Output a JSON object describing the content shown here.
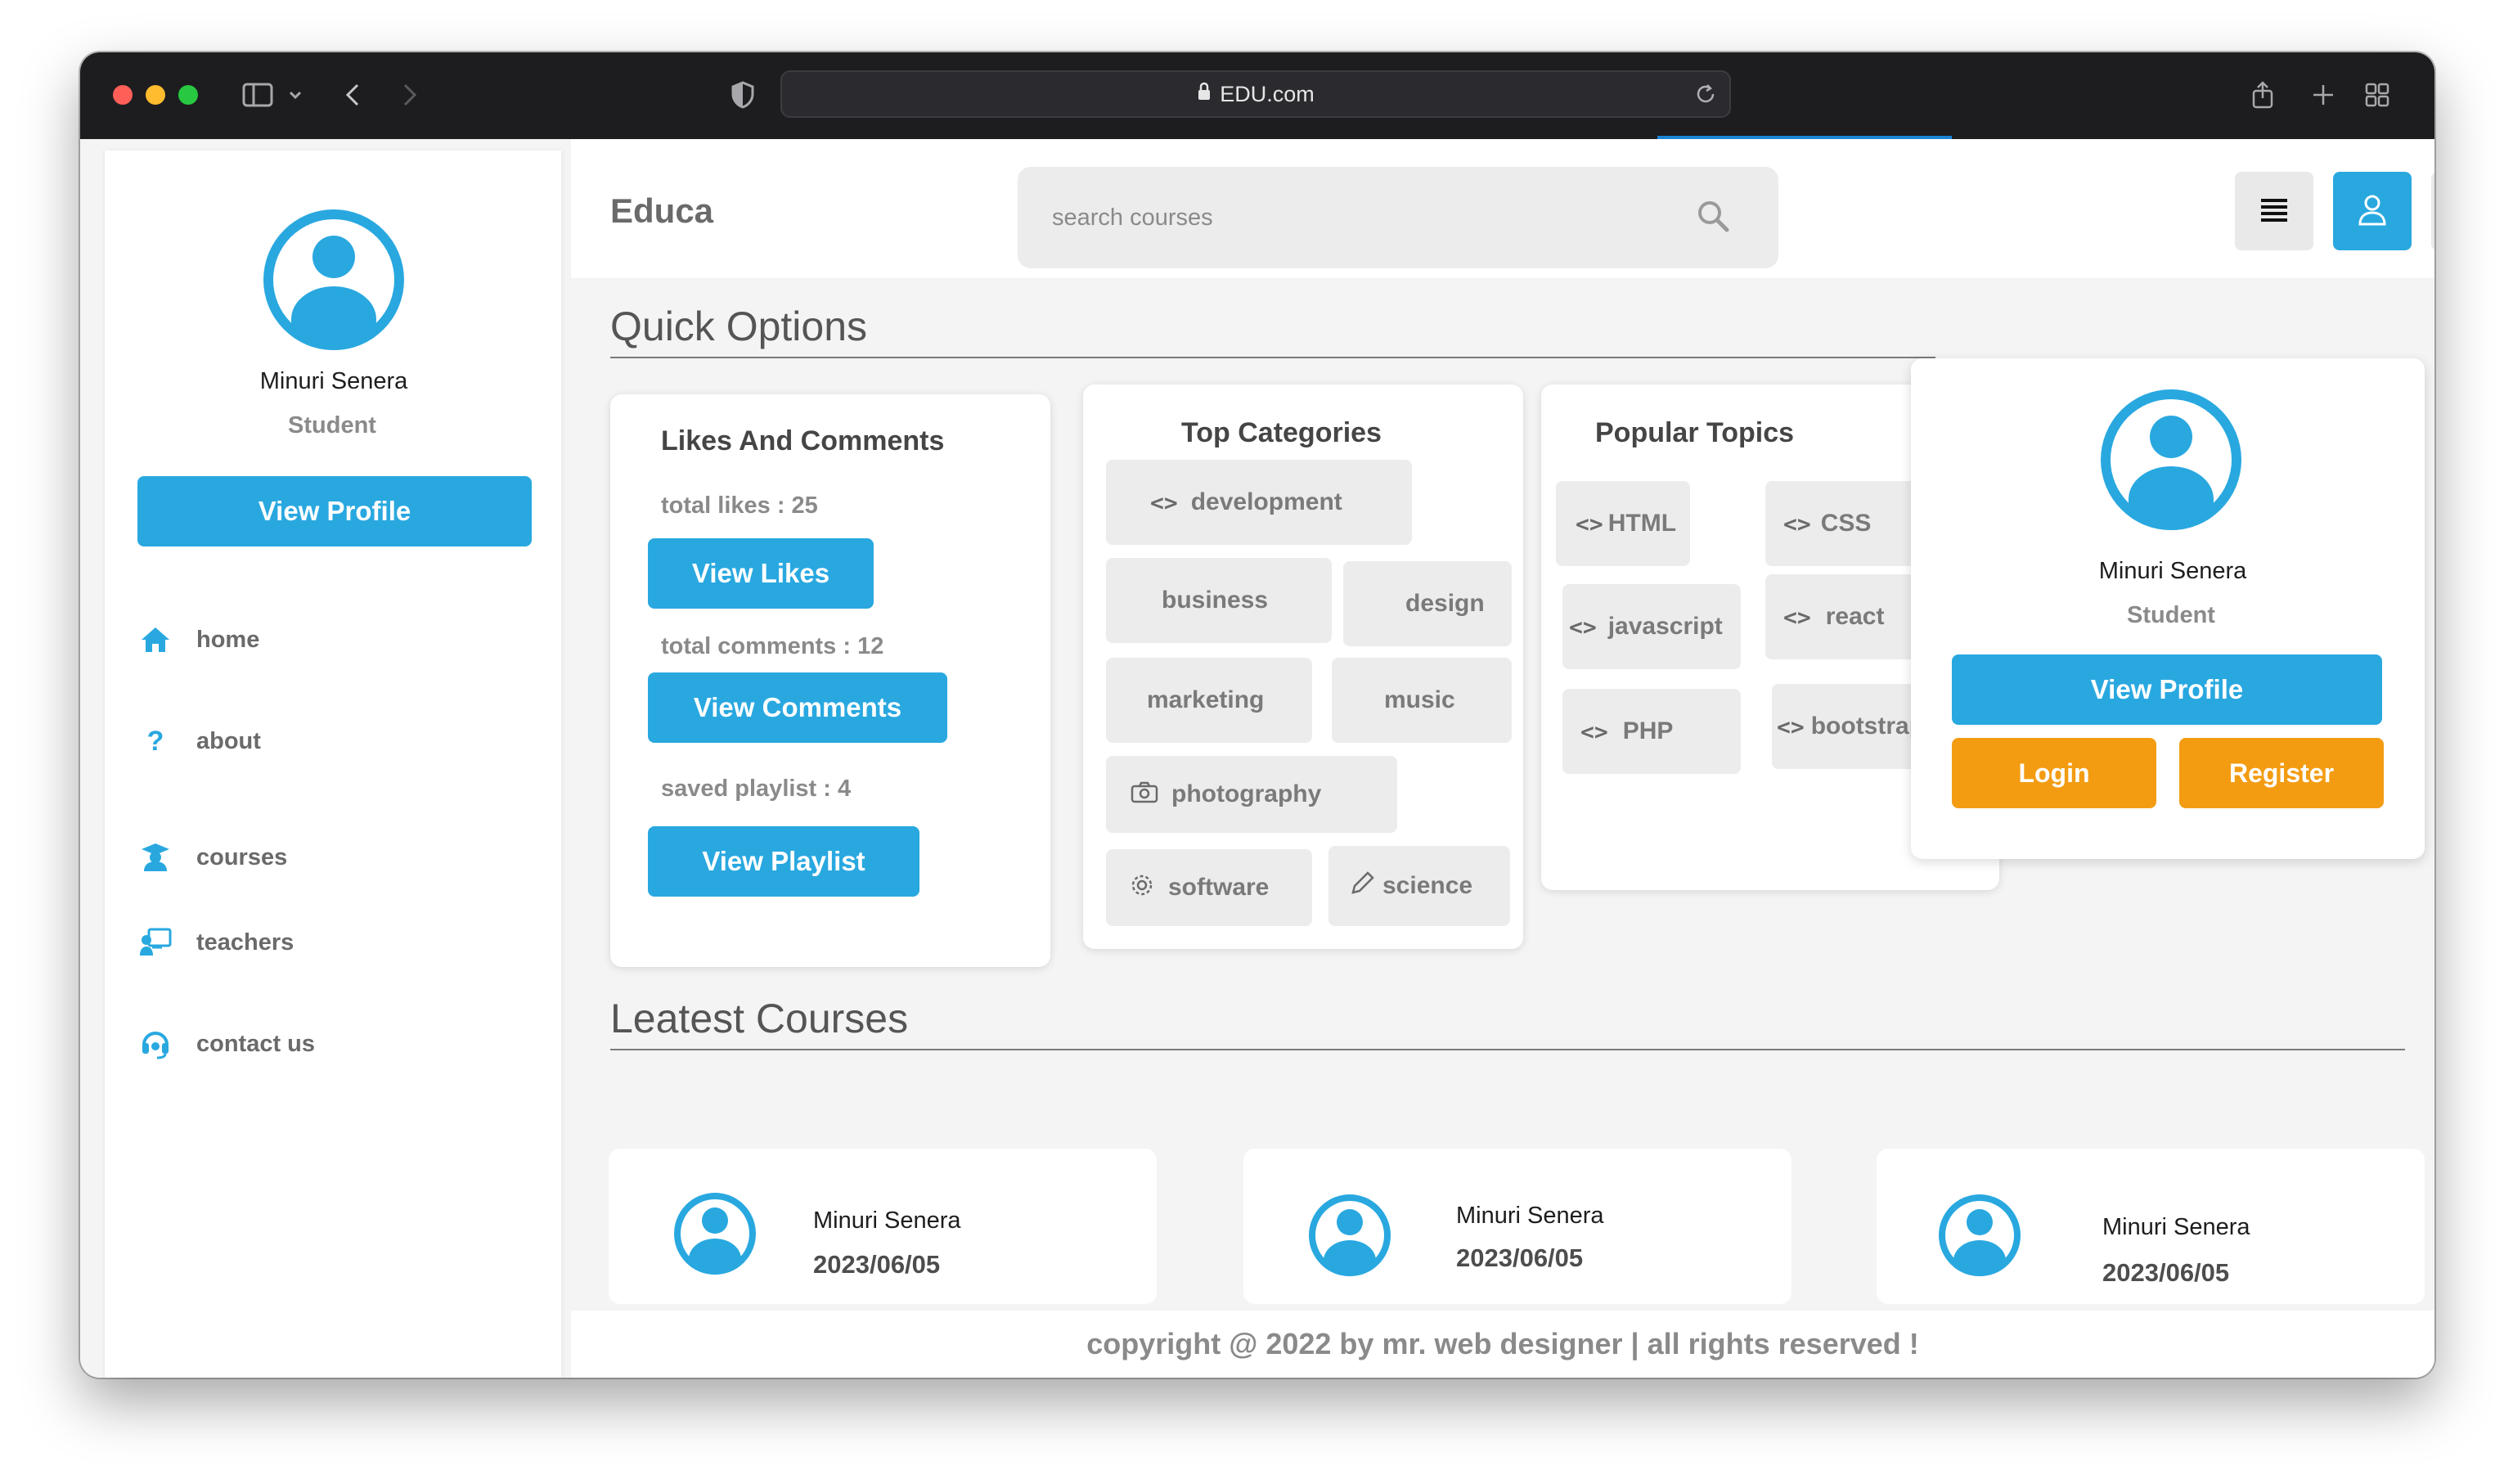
{
  "browser": {
    "url": "EDU.com"
  },
  "sidebar": {
    "profile": {
      "name": "Minuri Senera",
      "role": "Student",
      "button": "View Profile"
    },
    "nav": [
      {
        "label": "home",
        "icon": "home-icon"
      },
      {
        "label": "about",
        "icon": "question-icon"
      },
      {
        "label": "courses",
        "icon": "graduation-cap-icon"
      },
      {
        "label": "teachers",
        "icon": "chalkboard-teacher-icon"
      },
      {
        "label": "contact us",
        "icon": "headset-icon"
      }
    ]
  },
  "header": {
    "logo": "Educa",
    "search_placeholder": "search courses"
  },
  "quick_options": {
    "title": "Quick Options",
    "likes_card": {
      "title": "Likes And Comments",
      "total_likes": "total likes : 25",
      "view_likes": "View Likes",
      "total_comments": "total comments : 12",
      "view_comments": "View Comments",
      "saved_playlist": "saved playlist : 4",
      "view_playlist": "View Playlist"
    },
    "categories_card": {
      "title": "Top Categories",
      "tags": [
        "development",
        "business",
        "design",
        "marketing",
        "music",
        "photography",
        "software",
        "science"
      ]
    },
    "topics_card": {
      "title": "Popular Topics",
      "tags": [
        "HTML",
        "CSS",
        "javascript",
        "react",
        "PHP",
        "bootstrap"
      ]
    }
  },
  "latest_courses": {
    "title": "Leatest Courses",
    "items": [
      {
        "name": "Minuri Senera",
        "date": "2023/06/05"
      },
      {
        "name": "Minuri Senera",
        "date": "2023/06/05"
      },
      {
        "name": "Minuri Senera",
        "date": "2023/06/05"
      }
    ]
  },
  "popup": {
    "name": "Minuri Senera",
    "role": "Student",
    "view_profile": "View Profile",
    "login": "Login",
    "register": "Register"
  },
  "footer": {
    "text": "copyright @ 2022 by mr. web designer | all rights reserved !"
  },
  "colors": {
    "accent": "#29a8e0",
    "orange": "#f39c12",
    "titlebar": "#1d1d20"
  }
}
